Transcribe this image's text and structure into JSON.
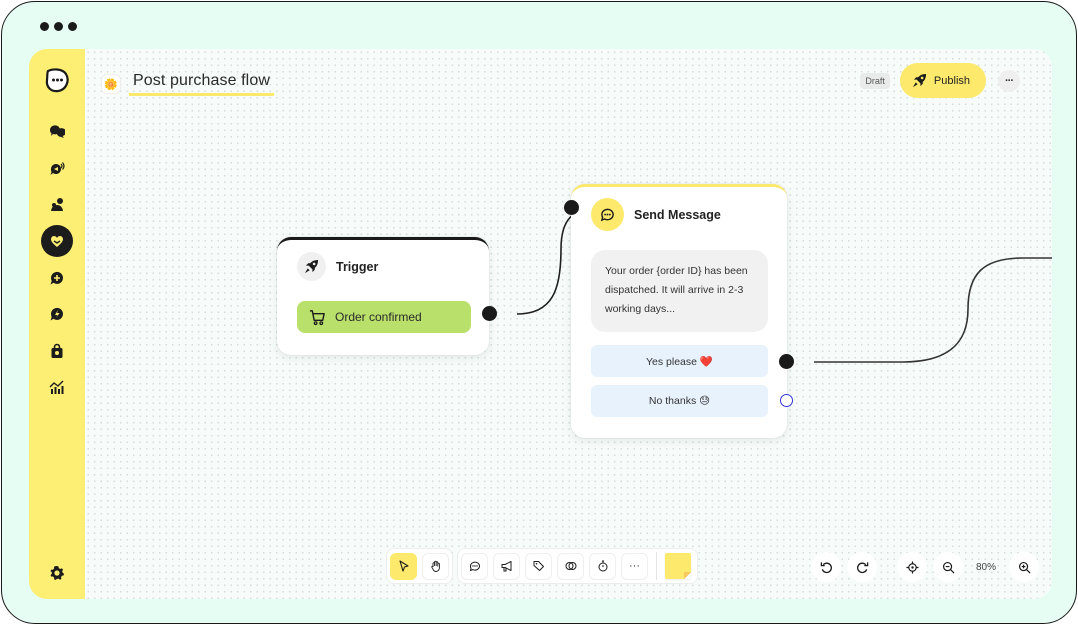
{
  "window": {
    "controls": [
      "dot",
      "dot",
      "dot"
    ]
  },
  "sidebar": {
    "logo": "chat-bubble-logo-icon",
    "items": [
      {
        "name": "conversations",
        "icon": "chat-bubbles-icon",
        "active": false
      },
      {
        "name": "broadcast",
        "icon": "chat-broadcast-icon",
        "active": false
      },
      {
        "name": "contacts",
        "icon": "contacts-icon",
        "active": false
      },
      {
        "name": "flows",
        "icon": "flows-heart-icon",
        "active": true
      },
      {
        "name": "add",
        "icon": "chat-plus-icon",
        "active": false
      },
      {
        "name": "automations",
        "icon": "chat-bolt-icon",
        "active": false
      },
      {
        "name": "shop",
        "icon": "shopping-bag-icon",
        "active": false
      },
      {
        "name": "analytics",
        "icon": "analytics-icon",
        "active": false
      }
    ],
    "settings_icon": "gear-icon"
  },
  "header": {
    "title_emoji": "🌼",
    "title": "Post purchase flow",
    "status_badge": "Draft",
    "publish_label": "Publish",
    "more_label": "···"
  },
  "nodes": {
    "trigger": {
      "title": "Trigger",
      "icon": "rocket-icon",
      "event_label": "Order confirmed",
      "event_icon": "cart-icon"
    },
    "send_message": {
      "title": "Send Message",
      "icon": "chat-dots-icon",
      "message": "Your order {order ID} has been dispatched. It will arrive in 2-3 working days...",
      "replies": [
        {
          "label": "Yes please ❤️",
          "connected": true
        },
        {
          "label": "No thanks 😓",
          "connected": false
        }
      ]
    }
  },
  "toolbar": {
    "tools": [
      {
        "name": "select",
        "icon": "pointer-icon",
        "active": true
      },
      {
        "name": "pan",
        "icon": "hand-icon",
        "active": false
      }
    ],
    "nodes": [
      {
        "name": "message",
        "icon": "chat-dots-icon"
      },
      {
        "name": "broadcast",
        "icon": "megaphone-icon"
      },
      {
        "name": "tag",
        "icon": "tag-icon"
      },
      {
        "name": "condition",
        "icon": "split-icon"
      },
      {
        "name": "delay",
        "icon": "stopwatch-icon"
      },
      {
        "name": "more",
        "icon": "more-icon",
        "label": "···"
      }
    ],
    "sticky_note": "sticky-note-icon"
  },
  "zoom_controls": {
    "undo": "undo-icon",
    "redo": "redo-icon",
    "recenter": "crosshair-icon",
    "zoom_out": "zoom-out-icon",
    "zoom_level": "80%",
    "zoom_in": "zoom-in-icon"
  },
  "colors": {
    "brand_yellow": "#fde96b",
    "frame_mint": "#e6fdf4",
    "trigger_green": "#b8e06a",
    "reply_blue": "#e8f2fd",
    "dark": "#1a1a1a",
    "empty_handle": "#3434d6"
  }
}
